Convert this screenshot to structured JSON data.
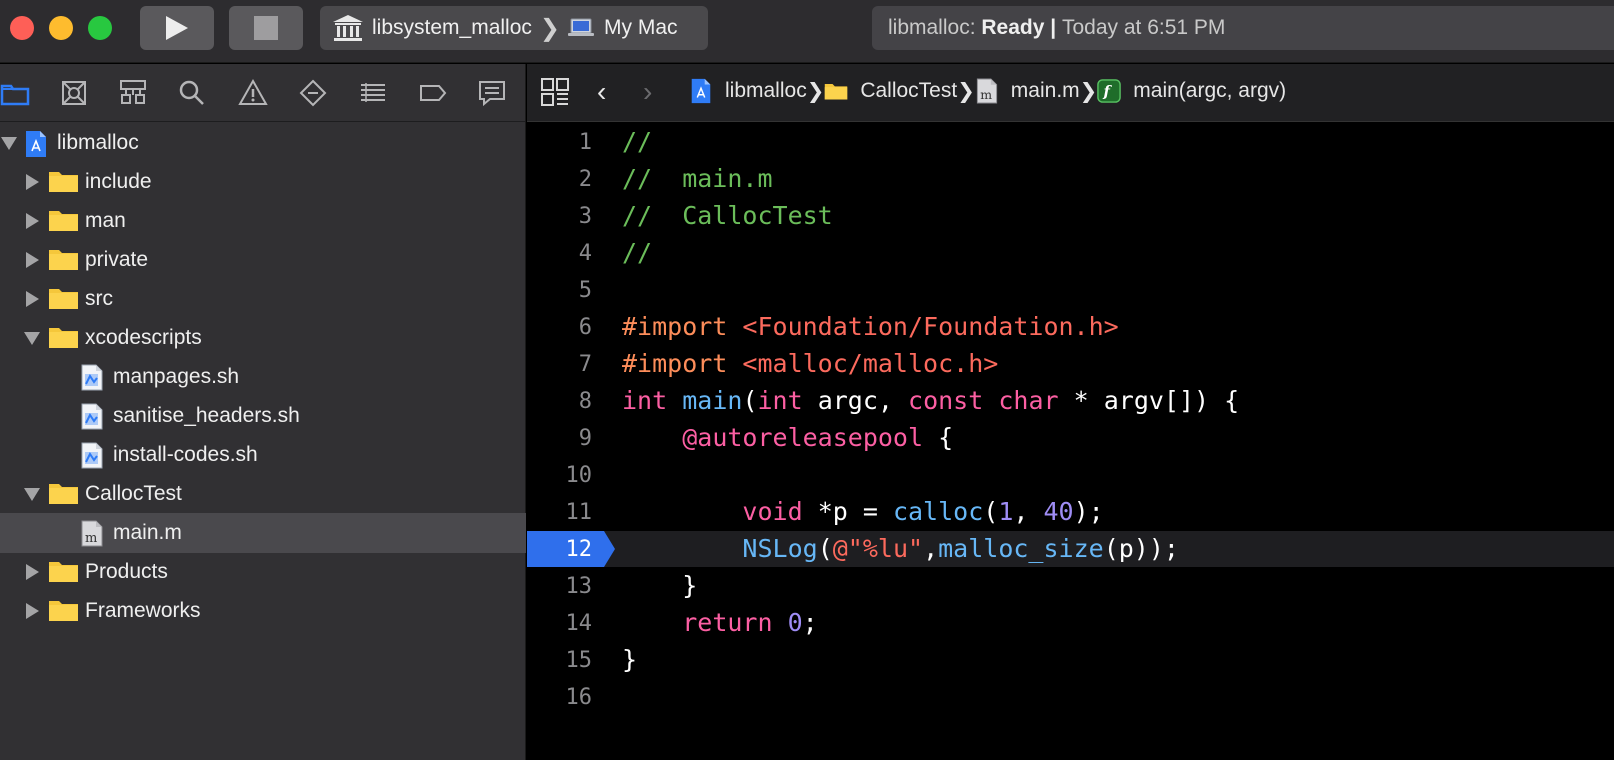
{
  "toolbar": {
    "scheme_project": "libsystem_malloc",
    "scheme_destination": "My Mac",
    "status_target": "libmalloc:",
    "status_state": "Ready",
    "status_sep": "|",
    "status_time": "Today at 6:51 PM"
  },
  "navigator": {
    "tabs": [
      "folder-icon",
      "x-square-icon",
      "hierarchy-icon",
      "search-icon",
      "warning-icon",
      "diamond-icon",
      "list-icon",
      "tag-icon",
      "message-icon"
    ],
    "items": [
      {
        "label": "libmalloc",
        "kind": "project",
        "depth": 0,
        "disclosure": "open"
      },
      {
        "label": "include",
        "kind": "folder",
        "depth": 1,
        "disclosure": "closed"
      },
      {
        "label": "man",
        "kind": "folder",
        "depth": 1,
        "disclosure": "closed"
      },
      {
        "label": "private",
        "kind": "folder",
        "depth": 1,
        "disclosure": "closed"
      },
      {
        "label": "src",
        "kind": "folder",
        "depth": 1,
        "disclosure": "closed"
      },
      {
        "label": "xcodescripts",
        "kind": "folder",
        "depth": 1,
        "disclosure": "open"
      },
      {
        "label": "manpages.sh",
        "kind": "script",
        "depth": 2,
        "disclosure": "none"
      },
      {
        "label": "sanitise_headers.sh",
        "kind": "script",
        "depth": 2,
        "disclosure": "none"
      },
      {
        "label": "install-codes.sh",
        "kind": "script",
        "depth": 2,
        "disclosure": "none"
      },
      {
        "label": "CallocTest",
        "kind": "folder",
        "depth": 1,
        "disclosure": "open"
      },
      {
        "label": "main.m",
        "kind": "objc",
        "depth": 2,
        "disclosure": "none",
        "selected": true
      },
      {
        "label": "Products",
        "kind": "folder",
        "depth": 1,
        "disclosure": "closed"
      },
      {
        "label": "Frameworks",
        "kind": "folder",
        "depth": 1,
        "disclosure": "closed"
      }
    ]
  },
  "jumpbar": {
    "crumbs": [
      {
        "label": "libmalloc",
        "icon": "project-icon"
      },
      {
        "label": "CallocTest",
        "icon": "folder-icon"
      },
      {
        "label": "main.m",
        "icon": "objc-file-icon"
      },
      {
        "label": "main(argc, argv)",
        "icon": "function-icon"
      }
    ]
  },
  "editor": {
    "current_line": 12,
    "lines": [
      [
        {
          "t": "//",
          "c": "comment"
        }
      ],
      [
        {
          "t": "//  main.m",
          "c": "comment"
        }
      ],
      [
        {
          "t": "//  CallocTest",
          "c": "comment"
        }
      ],
      [
        {
          "t": "//",
          "c": "comment"
        }
      ],
      [],
      [
        {
          "t": "#import ",
          "c": "prep"
        },
        {
          "t": "<Foundation/Foundation.h>",
          "c": "str"
        }
      ],
      [
        {
          "t": "#import ",
          "c": "prep"
        },
        {
          "t": "<malloc/malloc.h>",
          "c": "str"
        }
      ],
      [
        {
          "t": "int",
          "c": "kw"
        },
        {
          "t": " ",
          "c": "plain"
        },
        {
          "t": "main",
          "c": "fn"
        },
        {
          "t": "(",
          "c": "plain"
        },
        {
          "t": "int",
          "c": "kw"
        },
        {
          "t": " argc, ",
          "c": "plain"
        },
        {
          "t": "const",
          "c": "kw"
        },
        {
          "t": " ",
          "c": "plain"
        },
        {
          "t": "char",
          "c": "kw"
        },
        {
          "t": " * argv[]) {",
          "c": "plain"
        }
      ],
      [
        {
          "t": "    ",
          "c": "plain"
        },
        {
          "t": "@autoreleasepool",
          "c": "kw"
        },
        {
          "t": " {",
          "c": "plain"
        }
      ],
      [],
      [
        {
          "t": "        ",
          "c": "plain"
        },
        {
          "t": "void",
          "c": "kw"
        },
        {
          "t": " *p = ",
          "c": "plain"
        },
        {
          "t": "calloc",
          "c": "fn"
        },
        {
          "t": "(",
          "c": "plain"
        },
        {
          "t": "1",
          "c": "num"
        },
        {
          "t": ", ",
          "c": "plain"
        },
        {
          "t": "40",
          "c": "num"
        },
        {
          "t": ");",
          "c": "plain"
        }
      ],
      [
        {
          "t": "        ",
          "c": "plain"
        },
        {
          "t": "NSLog",
          "c": "fn"
        },
        {
          "t": "(",
          "c": "plain"
        },
        {
          "t": "@\"%lu\"",
          "c": "str"
        },
        {
          "t": ",",
          "c": "plain"
        },
        {
          "t": "malloc_size",
          "c": "fn"
        },
        {
          "t": "(p));",
          "c": "plain"
        }
      ],
      [
        {
          "t": "    }",
          "c": "plain"
        }
      ],
      [
        {
          "t": "    ",
          "c": "plain"
        },
        {
          "t": "return",
          "c": "kw"
        },
        {
          "t": " ",
          "c": "plain"
        },
        {
          "t": "0",
          "c": "num"
        },
        {
          "t": ";",
          "c": "plain"
        }
      ],
      [
        {
          "t": "}",
          "c": "plain"
        }
      ],
      []
    ]
  },
  "colors": {
    "accent_blue": "#2f6fec",
    "folder_yellow": "#f5c73b",
    "comment": "#6bbd5a",
    "keyword": "#fc5fa3",
    "string": "#fc6a5d",
    "preprocessor": "#fd8d5a",
    "function": "#67b7f6",
    "number": "#9f8df5"
  }
}
